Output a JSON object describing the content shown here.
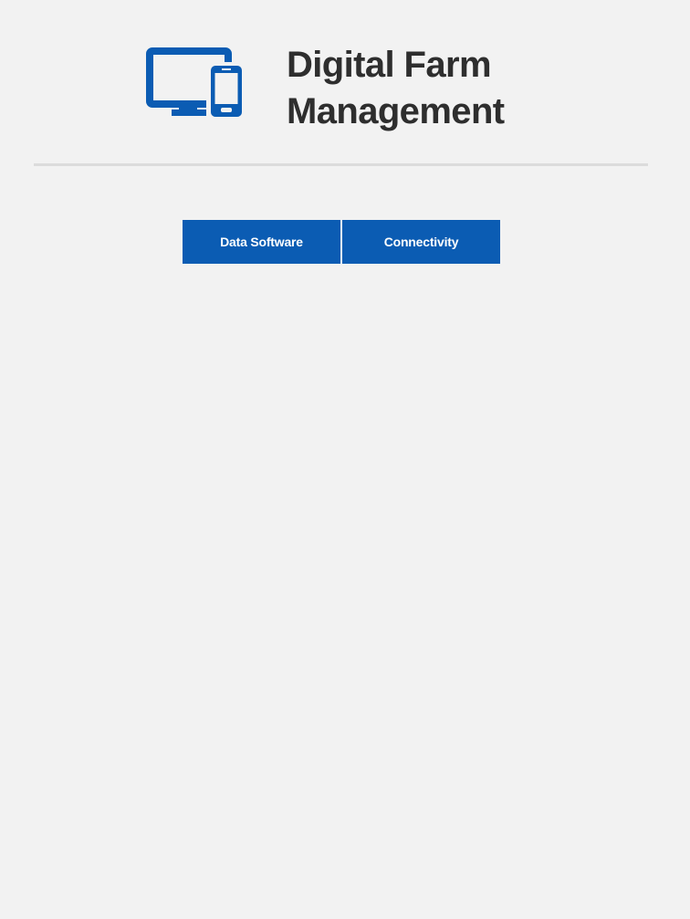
{
  "hero": {
    "icon": "desktop-and-mobile-device-icon",
    "title_line1": "Digital Farm",
    "title_line2": "Management"
  },
  "tabs": [
    {
      "label": "Data Software"
    },
    {
      "label": "Connectivity"
    }
  ],
  "colors": {
    "accent": "#0b5cb3",
    "background": "#f2f2f2",
    "divider": "#dcdcdc",
    "title_text": "#2e2e2e"
  }
}
